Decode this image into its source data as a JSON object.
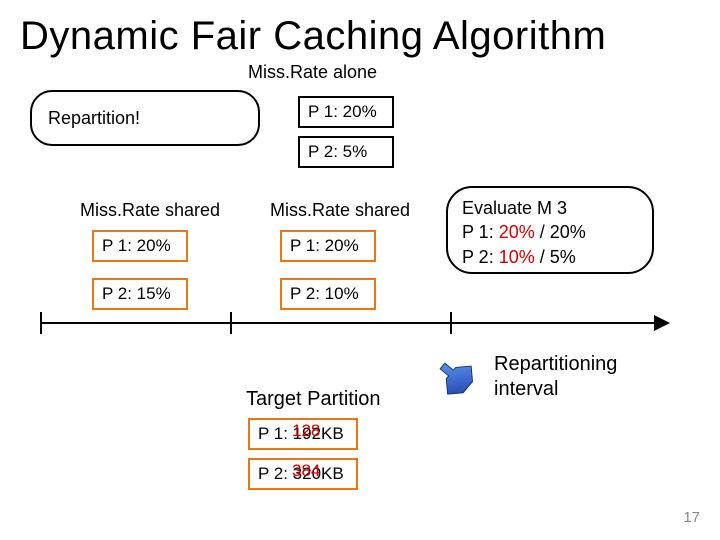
{
  "title": "Dynamic Fair Caching Algorithm",
  "miss_rate_alone_label": "Miss.Rate alone",
  "repartition_label": "Repartition!",
  "alone": {
    "p1": "P 1: 20%",
    "p2": "P 2: 5%"
  },
  "shared_label_1": "Miss.Rate shared",
  "shared_label_2": "Miss.Rate shared",
  "shared1": {
    "p1": "P 1: 20%",
    "p2": "P 2: 15%"
  },
  "shared2": {
    "p1": "P 1: 20%",
    "p2": "P 2: 10%"
  },
  "eval": {
    "l1": "Evaluate M 3",
    "l2a": "P 1: ",
    "l2b": "20%",
    "l2c": " / 20%",
    "l3a": "P 2: ",
    "l3b": "10%",
    "l3c": " / 5%"
  },
  "repart_interval": "Repartitioning\ninterval",
  "target_label": "Target Partition",
  "target": {
    "p1_base": "P 1: 192KB",
    "p1_over": "128",
    "p2_base": "P 2: 320KB",
    "p2_over": "384"
  },
  "page": "17"
}
